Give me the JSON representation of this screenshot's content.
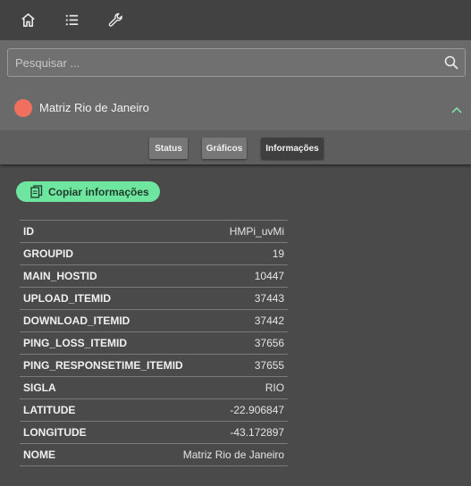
{
  "topbar": {
    "icons": [
      "home-icon",
      "list-icon",
      "wrench-icon"
    ]
  },
  "search": {
    "placeholder": "Pesquisar ...",
    "value": ""
  },
  "unit": {
    "name": "Matriz Rio de Janeiro",
    "status_color": "#f07060"
  },
  "tabs": [
    {
      "label": "Status"
    },
    {
      "label": "Gráficos"
    },
    {
      "label": "Informações"
    }
  ],
  "copy_button": {
    "label": "Copiar informações",
    "color": "#6fe6a0"
  },
  "info": [
    {
      "key": "ID",
      "value": "HMPi_uvMi"
    },
    {
      "key": "GROUPID",
      "value": "19"
    },
    {
      "key": "MAIN_HOSTID",
      "value": "10447"
    },
    {
      "key": "UPLOAD_ITEMID",
      "value": "37443"
    },
    {
      "key": "DOWNLOAD_ITEMID",
      "value": "37442"
    },
    {
      "key": "PING_LOSS_ITEMID",
      "value": "37656"
    },
    {
      "key": "PING_RESPONSETIME_ITEMID",
      "value": "37655"
    },
    {
      "key": "SIGLA",
      "value": "RIO"
    },
    {
      "key": "LATITUDE",
      "value": "-22.906847"
    },
    {
      "key": "LONGITUDE",
      "value": "-43.172897"
    },
    {
      "key": "NOME",
      "value": "Matriz Rio de Janeiro"
    }
  ]
}
